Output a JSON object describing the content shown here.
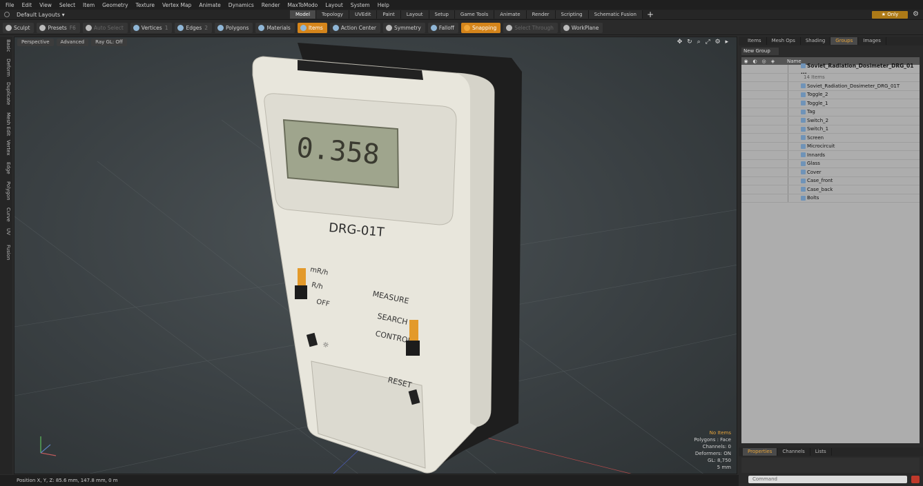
{
  "menu": [
    "File",
    "Edit",
    "View",
    "Select",
    "Item",
    "Geometry",
    "Texture",
    "Vertex Map",
    "Animate",
    "Dynamics",
    "Render",
    "MaxToModo",
    "Layout",
    "System",
    "Help"
  ],
  "layouts_label": "Default Layouts ▾",
  "mode_tabs": [
    "Model",
    "Topology",
    "UVEdit",
    "Paint",
    "Layout",
    "Setup",
    "Game Tools",
    "Animate",
    "Render",
    "Scripting",
    "Schematic Fusion"
  ],
  "active_mode": "Model",
  "only_label": "★ Only",
  "toolbar": {
    "sculpt": "Sculpt",
    "presets": "Presets",
    "presets_key": "F6",
    "auto_select": "Auto Select",
    "vertices": "Vertices",
    "vertices_num": "1",
    "edges": "Edges",
    "edges_num": "2",
    "polygons": "Polygons",
    "materials": "Materials",
    "items": "Items",
    "action_center": "Action Center",
    "symmetry": "Symmetry",
    "falloff": "Falloff",
    "snapping": "Snapping",
    "select_through": "Select Through",
    "workplane": "WorkPlane"
  },
  "left_tabs": [
    "Basic",
    "Deform",
    "Duplicate",
    "Mesh Edit",
    "Vertex",
    "Edge",
    "Polygon",
    "Curve",
    "UV",
    "Fusion"
  ],
  "viewport": {
    "view": "Perspective",
    "shading": "Advanced",
    "raygl": "Ray GL: Off"
  },
  "device": {
    "display": "0.358",
    "model": "DRG-01T",
    "labels": [
      "mR/h",
      "R/h",
      "OFF",
      "MEASURE",
      "SEARCH",
      "CONTROL",
      "RESET"
    ]
  },
  "stats": {
    "selection": "No Items",
    "polygons": "Polygons : Face",
    "channels": "Channels: 0",
    "deformers": "Deformers: ON",
    "gl": "GL: 8,750",
    "scale": "5 mm"
  },
  "status_text": "Position X, Y, Z:  85.6 mm, 147.8 mm, 0 m",
  "right_tabs": [
    "Items",
    "Mesh Ops",
    "Shading",
    "Groups",
    "Images"
  ],
  "active_right_tab": "Groups",
  "new_group": "New Group",
  "tree_header": "Name",
  "tree": {
    "root": "Soviet_Radiation_Dosimeter_DRG_01 ...",
    "count": "14 Items",
    "items": [
      "Soviet_Radiation_Dosimeter_DRG_01T",
      "Toggle_2",
      "Toggle_1",
      "Tag",
      "Switch_2",
      "Switch_1",
      "Screen",
      "Microcircuit",
      "Innards",
      "Glass",
      "Cover",
      "Case_front",
      "Case_back",
      "Bolts"
    ]
  },
  "prop_tabs": [
    "Properties",
    "Channels",
    "Lists"
  ],
  "command_placeholder": "Command"
}
